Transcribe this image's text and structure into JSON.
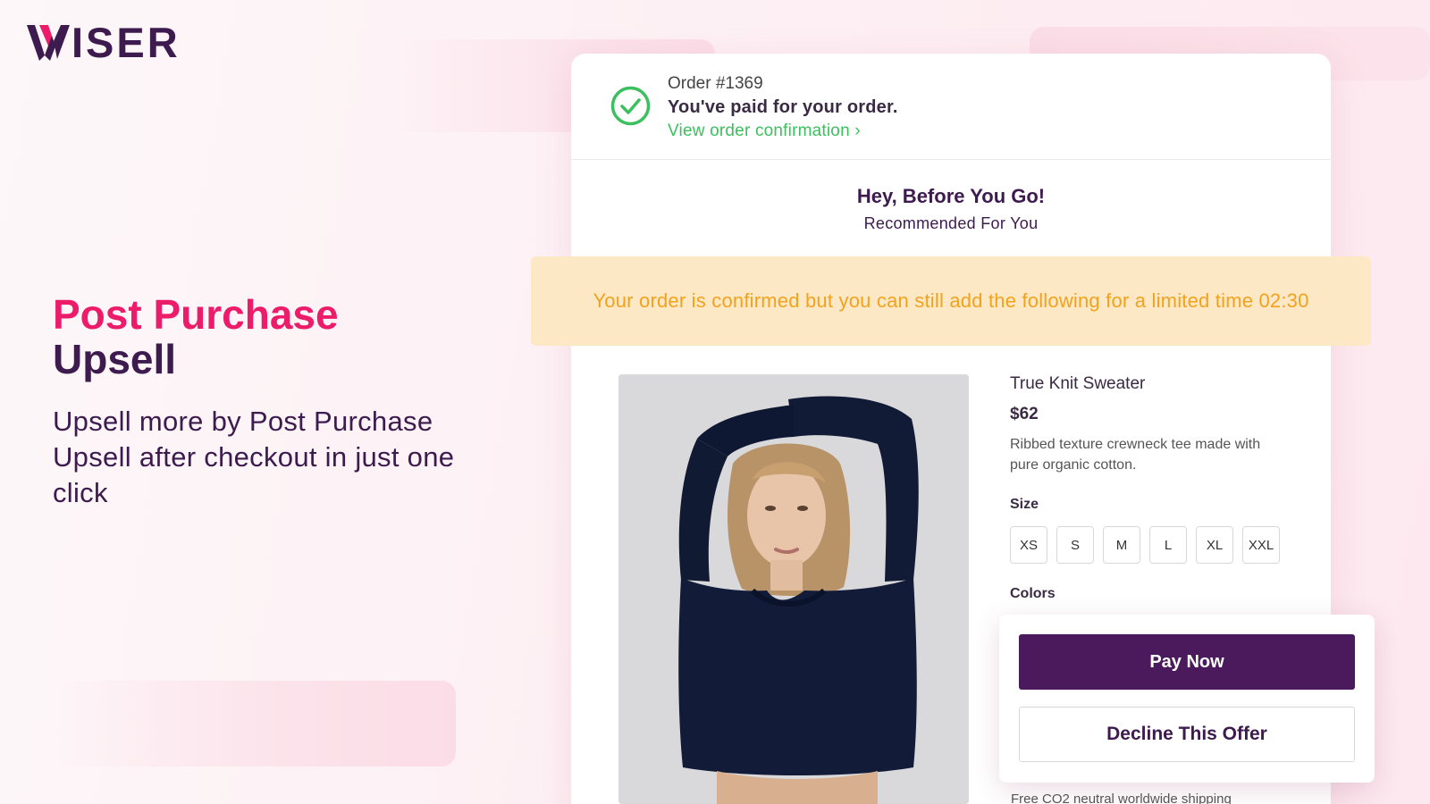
{
  "brand": {
    "logo_text": "ISER",
    "logo_full": "WISER",
    "colors": {
      "brand_dark": "#3d1b4e",
      "brand_pink": "#ec1c6a",
      "success": "#3cbf5e",
      "warning_text": "#f2a21c",
      "warning_bg": "#fde8c6"
    }
  },
  "hero": {
    "title_line1": "Post Purchase",
    "title_line2": "Upsell",
    "subtitle": "Upsell more by Post Purchase Upsell after checkout in just one click"
  },
  "order": {
    "number": "Order #1369",
    "status": "You've paid for your order.",
    "link": "View order confirmation ›",
    "icon": "check-circle-icon"
  },
  "upsell": {
    "heading": "Hey, Before You Go!",
    "subheading": "Recommended For You",
    "banner": "Your order is confirmed but you can still add the following for a limited time 02:30"
  },
  "product": {
    "name": "True Knit Sweater",
    "price": "$62",
    "description": "Ribbed texture crewneck tee made with pure organic cotton.",
    "size_label": "Size",
    "sizes": [
      "XS",
      "S",
      "M",
      "L",
      "XL",
      "XXL"
    ],
    "colors_label": "Colors",
    "shipping": "Free CO2 neutral worldwide shipping"
  },
  "actions": {
    "pay": "Pay Now",
    "decline": "Decline This Offer"
  }
}
